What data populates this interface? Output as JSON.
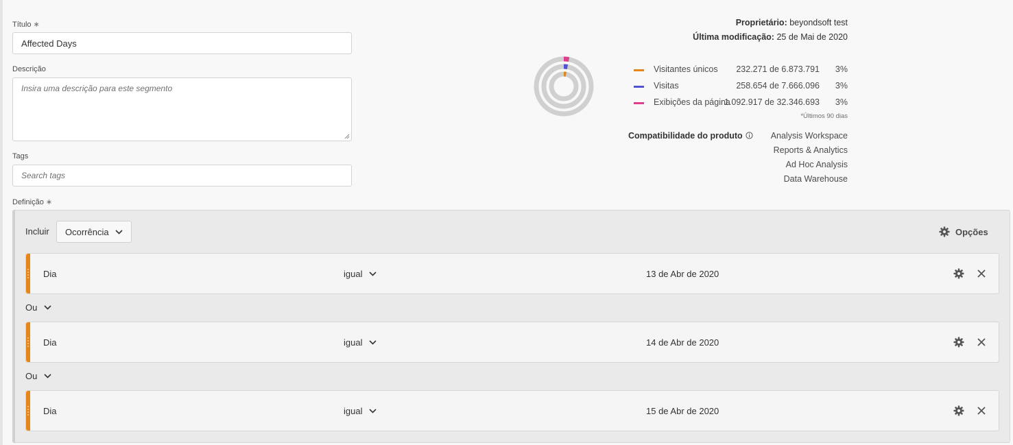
{
  "form": {
    "title_label": "Título",
    "required_mark": "∗",
    "title_value": "Affected Days",
    "description_label": "Descrição",
    "description_placeholder": "Insira uma descrição para este segmento",
    "tags_label": "Tags",
    "tags_placeholder": "Search tags",
    "definition_label": "Definição"
  },
  "meta": {
    "owner_label": "Proprietário:",
    "owner_value": "beyondsoft test",
    "modified_label": "Última modificação:",
    "modified_value": "25 de Mai de 2020"
  },
  "summary": {
    "rows": [
      {
        "name": "Visitantes únicos",
        "value": "232.271",
        "of": "de",
        "total": "6.873.791",
        "pct": "3%",
        "color": "#e68619",
        "fraction": 0.03
      },
      {
        "name": "Visitas",
        "value": "258.654",
        "of": "de",
        "total": "7.666.096",
        "pct": "3%",
        "color": "#5151d3",
        "fraction": 0.03
      },
      {
        "name": "Exibições da página",
        "value": "1.092.917",
        "of": "de",
        "total": "32.346.693",
        "pct": "3%",
        "color": "#e03e8c",
        "fraction": 0.03
      }
    ],
    "footnote": "*Últimos 90 dias"
  },
  "compatibility": {
    "label": "Compatibilidade do produto",
    "items": [
      "Analysis Workspace",
      "Reports & Analytics",
      "Ad Hoc Analysis",
      "Data Warehouse"
    ]
  },
  "definition": {
    "include_label": "Incluir",
    "scope_value": "Ocorrência",
    "options_label": "Opções",
    "rules": [
      {
        "dimension": "Dia",
        "operator": "igual",
        "value": "13 de Abr de 2020"
      },
      {
        "dimension": "Dia",
        "operator": "igual",
        "value": "14 de Abr de 2020"
      },
      {
        "dimension": "Dia",
        "operator": "igual",
        "value": "15 de Abr de 2020"
      }
    ],
    "connector": "Ou"
  },
  "icons": {
    "gear": "gear-icon",
    "close": "close-icon",
    "chevron": "chevron-down-icon",
    "info": "info-icon",
    "drag": "drag-handle-icon"
  }
}
